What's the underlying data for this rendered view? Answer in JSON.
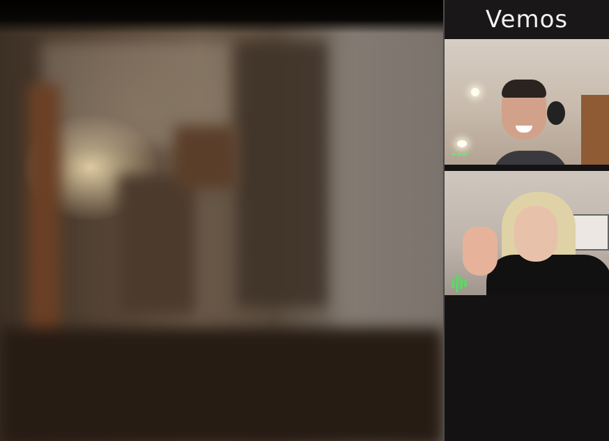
{
  "app": {
    "brand": "Vemos"
  },
  "participants": [
    {
      "id": "participant-1",
      "audio_state": "idle",
      "audio_bars": [
        1,
        1,
        1
      ]
    },
    {
      "id": "participant-2",
      "audio_state": "speaking",
      "audio_bars": [
        0.6,
        1.0,
        0.6,
        0.35
      ]
    }
  ],
  "colors": {
    "audio_indicator": "#62d36a",
    "sidebar_bg": "#141213",
    "logo_text": "#f2f2f2",
    "divider": "#4e4b4c"
  }
}
